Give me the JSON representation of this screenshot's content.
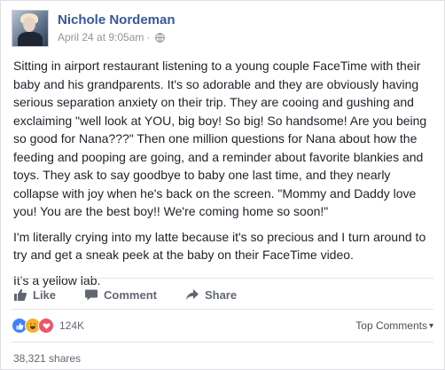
{
  "post": {
    "author": "Nichole Nordeman",
    "timestamp": "April 24 at 9:05am",
    "separator": "·",
    "paragraphs": [
      "Sitting in airport restaurant listening to a young couple FaceTime with their baby and his grandparents. It's so adorable and they are obviously having serious separation anxiety on their trip. They are cooing and gushing and exclaiming \"well look at YOU, big boy! So big! So handsome! Are you being so good for Nana???\" Then one million questions for Nana about how the feeding and pooping are going, and a reminder about favorite blankies and toys. They ask to say goodbye to baby one last time, and they nearly collapse with joy when he's back on the screen. \"Mommy and Daddy love you! You are the best boy!! We're coming home so soon!\"",
      "I'm literally crying into my latte because it's so precious and I turn around to try and get a sneak peek at the baby on their FaceTime video.",
      "It's a yellow lab."
    ]
  },
  "actions": {
    "like": "Like",
    "comment": "Comment",
    "share": "Share"
  },
  "stats": {
    "reaction_count": "124K",
    "sort_label": "Top Comments",
    "sort_caret": "▾",
    "shares": "38,321 shares"
  },
  "colors": {
    "name": "#365899",
    "like": "#4080ff",
    "haha": "#f7b125",
    "love": "#f25268"
  }
}
